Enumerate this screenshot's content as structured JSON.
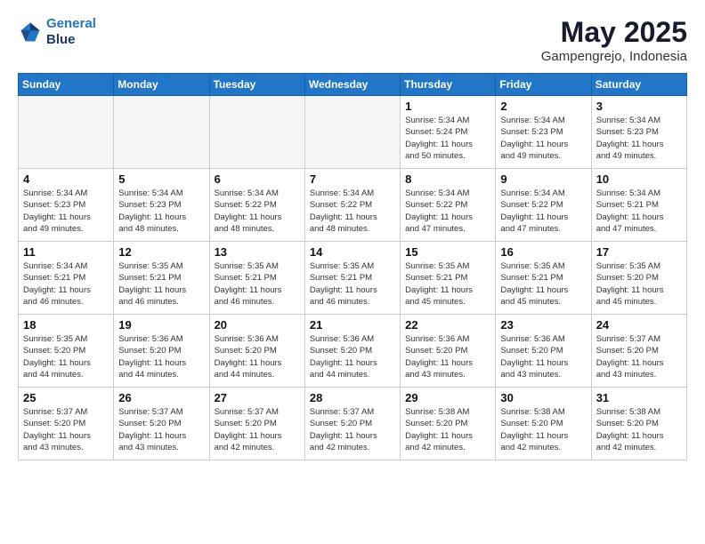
{
  "header": {
    "logo_line1": "General",
    "logo_line2": "Blue",
    "month": "May 2025",
    "location": "Gampengrejo, Indonesia"
  },
  "weekdays": [
    "Sunday",
    "Monday",
    "Tuesday",
    "Wednesday",
    "Thursday",
    "Friday",
    "Saturday"
  ],
  "weeks": [
    [
      {
        "day": "",
        "info": ""
      },
      {
        "day": "",
        "info": ""
      },
      {
        "day": "",
        "info": ""
      },
      {
        "day": "",
        "info": ""
      },
      {
        "day": "1",
        "info": "Sunrise: 5:34 AM\nSunset: 5:24 PM\nDaylight: 11 hours\nand 50 minutes."
      },
      {
        "day": "2",
        "info": "Sunrise: 5:34 AM\nSunset: 5:23 PM\nDaylight: 11 hours\nand 49 minutes."
      },
      {
        "day": "3",
        "info": "Sunrise: 5:34 AM\nSunset: 5:23 PM\nDaylight: 11 hours\nand 49 minutes."
      }
    ],
    [
      {
        "day": "4",
        "info": "Sunrise: 5:34 AM\nSunset: 5:23 PM\nDaylight: 11 hours\nand 49 minutes."
      },
      {
        "day": "5",
        "info": "Sunrise: 5:34 AM\nSunset: 5:23 PM\nDaylight: 11 hours\nand 48 minutes."
      },
      {
        "day": "6",
        "info": "Sunrise: 5:34 AM\nSunset: 5:22 PM\nDaylight: 11 hours\nand 48 minutes."
      },
      {
        "day": "7",
        "info": "Sunrise: 5:34 AM\nSunset: 5:22 PM\nDaylight: 11 hours\nand 48 minutes."
      },
      {
        "day": "8",
        "info": "Sunrise: 5:34 AM\nSunset: 5:22 PM\nDaylight: 11 hours\nand 47 minutes."
      },
      {
        "day": "9",
        "info": "Sunrise: 5:34 AM\nSunset: 5:22 PM\nDaylight: 11 hours\nand 47 minutes."
      },
      {
        "day": "10",
        "info": "Sunrise: 5:34 AM\nSunset: 5:21 PM\nDaylight: 11 hours\nand 47 minutes."
      }
    ],
    [
      {
        "day": "11",
        "info": "Sunrise: 5:34 AM\nSunset: 5:21 PM\nDaylight: 11 hours\nand 46 minutes."
      },
      {
        "day": "12",
        "info": "Sunrise: 5:35 AM\nSunset: 5:21 PM\nDaylight: 11 hours\nand 46 minutes."
      },
      {
        "day": "13",
        "info": "Sunrise: 5:35 AM\nSunset: 5:21 PM\nDaylight: 11 hours\nand 46 minutes."
      },
      {
        "day": "14",
        "info": "Sunrise: 5:35 AM\nSunset: 5:21 PM\nDaylight: 11 hours\nand 46 minutes."
      },
      {
        "day": "15",
        "info": "Sunrise: 5:35 AM\nSunset: 5:21 PM\nDaylight: 11 hours\nand 45 minutes."
      },
      {
        "day": "16",
        "info": "Sunrise: 5:35 AM\nSunset: 5:21 PM\nDaylight: 11 hours\nand 45 minutes."
      },
      {
        "day": "17",
        "info": "Sunrise: 5:35 AM\nSunset: 5:20 PM\nDaylight: 11 hours\nand 45 minutes."
      }
    ],
    [
      {
        "day": "18",
        "info": "Sunrise: 5:35 AM\nSunset: 5:20 PM\nDaylight: 11 hours\nand 44 minutes."
      },
      {
        "day": "19",
        "info": "Sunrise: 5:36 AM\nSunset: 5:20 PM\nDaylight: 11 hours\nand 44 minutes."
      },
      {
        "day": "20",
        "info": "Sunrise: 5:36 AM\nSunset: 5:20 PM\nDaylight: 11 hours\nand 44 minutes."
      },
      {
        "day": "21",
        "info": "Sunrise: 5:36 AM\nSunset: 5:20 PM\nDaylight: 11 hours\nand 44 minutes."
      },
      {
        "day": "22",
        "info": "Sunrise: 5:36 AM\nSunset: 5:20 PM\nDaylight: 11 hours\nand 43 minutes."
      },
      {
        "day": "23",
        "info": "Sunrise: 5:36 AM\nSunset: 5:20 PM\nDaylight: 11 hours\nand 43 minutes."
      },
      {
        "day": "24",
        "info": "Sunrise: 5:37 AM\nSunset: 5:20 PM\nDaylight: 11 hours\nand 43 minutes."
      }
    ],
    [
      {
        "day": "25",
        "info": "Sunrise: 5:37 AM\nSunset: 5:20 PM\nDaylight: 11 hours\nand 43 minutes."
      },
      {
        "day": "26",
        "info": "Sunrise: 5:37 AM\nSunset: 5:20 PM\nDaylight: 11 hours\nand 43 minutes."
      },
      {
        "day": "27",
        "info": "Sunrise: 5:37 AM\nSunset: 5:20 PM\nDaylight: 11 hours\nand 42 minutes."
      },
      {
        "day": "28",
        "info": "Sunrise: 5:37 AM\nSunset: 5:20 PM\nDaylight: 11 hours\nand 42 minutes."
      },
      {
        "day": "29",
        "info": "Sunrise: 5:38 AM\nSunset: 5:20 PM\nDaylight: 11 hours\nand 42 minutes."
      },
      {
        "day": "30",
        "info": "Sunrise: 5:38 AM\nSunset: 5:20 PM\nDaylight: 11 hours\nand 42 minutes."
      },
      {
        "day": "31",
        "info": "Sunrise: 5:38 AM\nSunset: 5:20 PM\nDaylight: 11 hours\nand 42 minutes."
      }
    ]
  ]
}
